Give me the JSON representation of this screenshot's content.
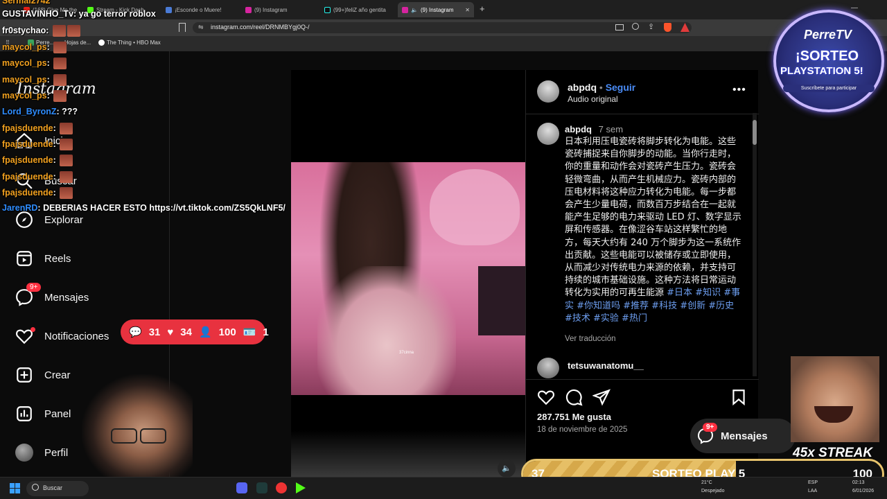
{
  "tabs": [
    {
      "label": "(168) Give Me the"
    },
    {
      "label": "Stream - Kick Dash"
    },
    {
      "label": "¡Esconde o Muere!"
    },
    {
      "label": "(9) Instagram"
    },
    {
      "label": "(99+)feliZ año gentita"
    },
    {
      "label": "(9) Instagram"
    }
  ],
  "address": {
    "url": "instagram.com/reel/DRNMBYgj0Q-/"
  },
  "bookmarks": [
    {
      "label": "Perre..."
    },
    {
      "label": "Hojas de..."
    },
    {
      "label": "The Thing • HBO Max"
    }
  ],
  "ig": {
    "logo": "Instagram",
    "nav": {
      "home": "Inicio",
      "search": "Buscar",
      "explore": "Explorar",
      "reels": "Reels",
      "messages": "Mensajes",
      "messages_badge": "9+",
      "notifications": "Notificaciones",
      "create": "Crear",
      "panel": "Panel",
      "profile": "Perfil"
    }
  },
  "post": {
    "author": "abpdq",
    "follow": "Seguir",
    "audio": "Audio original",
    "caption_user": "abpdq",
    "caption_time": "7 sem",
    "caption_text": "日本利用压电瓷砖将脚步转化为电能。这些瓷砖捕捉来自你脚步的动能。当你行走时，你的重量和动作会对瓷砖产生压力。瓷砖会轻微弯曲，从而产生机械应力。瓷砖内部的压电材料将这种应力转化为电能。每一步都会产生少量电荷，而数百万步结合在一起就能产生足够的电力来驱动 LED 灯、数字显示屏和传感器。在像涩谷车站这样繁忙的地方，每天大约有 240 万个脚步为这一系统作出贡献。这些电能可以被储存或立即使用，从而减少对传统电力来源的依赖，并支持可持续的城市基础设施。这种方法将日常运动转化为实用的可再生能源",
    "hashtags": "#日本 #知识 #事实 #你知道吗 #推荐 #科技 #创新 #历史 #技术 #实验 #热门",
    "see_translation": "Ver traducción",
    "comment_user": "tetsuwanatomu__",
    "likes": "287.751 Me gusta",
    "date": "18 de noviembre de 2025",
    "video_watermark": "37cinna"
  },
  "messages_float": {
    "label": "Mensajes",
    "badge": "9+"
  },
  "stream": {
    "stats": {
      "comments": "31",
      "likes": "34",
      "users": "100",
      "ids": "1"
    },
    "logo_title": "PerreTV",
    "logo_line1": "¡SORTEO",
    "logo_line2": "PLAYSTATION 5!",
    "logo_sub": "Suscríbete para participar",
    "streak": "45x STREAK",
    "progress": {
      "left": "37",
      "title": "SORTEO PLAY 5",
      "right": "100",
      "fraction": 0.37
    }
  },
  "chat": [
    {
      "user": "Sermal2742",
      "msg": ""
    },
    {
      "user": "GUSTAVINHO_Tv",
      "msg": "ya go terror roblox"
    },
    {
      "user": "fr0stychao",
      "msg": ""
    },
    {
      "user": "maycol_ps",
      "msg": ""
    },
    {
      "user": "maycol_ps",
      "msg": ""
    },
    {
      "user": "maycol_ps",
      "msg": ""
    },
    {
      "user": "maycol_ps",
      "msg": ""
    },
    {
      "user": "Lord_ByronZ",
      "msg": "???"
    },
    {
      "user": "fpajsduende",
      "msg": ""
    },
    {
      "user": "fpajsduende",
      "msg": ""
    },
    {
      "user": "fpajsduende",
      "msg": ""
    },
    {
      "user": "fpajsduende",
      "msg": ""
    },
    {
      "user": "fpajsduende",
      "msg": ""
    },
    {
      "user": "JarenRD",
      "msg": "DEBERIAS HACER ESTO https://vt.tiktok.com/ZS5QkLNF5/"
    }
  ],
  "taskbar": {
    "search": "Buscar",
    "weather_temp": "21°C",
    "weather_desc": "Despejado",
    "lang": "ESP",
    "lang2": "LAA",
    "time": "02:13",
    "date": "6/01/2026"
  }
}
